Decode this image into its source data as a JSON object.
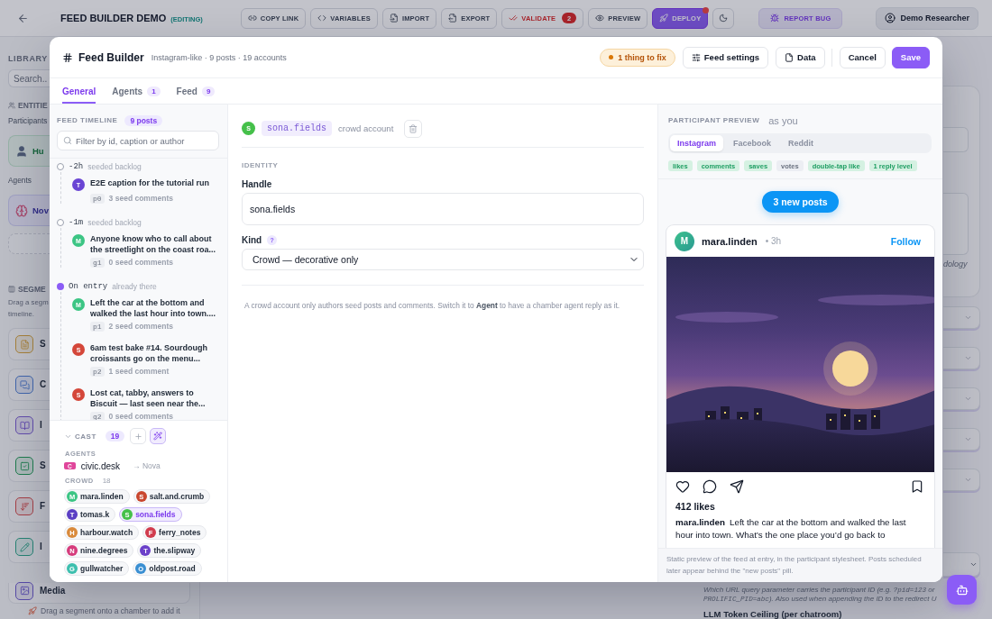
{
  "top_bar": {
    "title": "FEED BUILDER DEMO",
    "status": "(EDITING)",
    "actions": [
      {
        "kind": "link",
        "label": "COPY LINK",
        "alert": false
      },
      {
        "kind": "code",
        "label": "VARIABLES",
        "alert": false
      },
      {
        "kind": "import",
        "label": "IMPORT",
        "alert": false
      },
      {
        "kind": "export",
        "label": "EXPORT",
        "alert": false
      },
      {
        "kind": "validate",
        "label": "VALIDATE",
        "badge": "2",
        "alert": false
      },
      {
        "kind": "preview",
        "label": "PREVIEW",
        "alert": false
      },
      {
        "kind": "deploy",
        "label": "DEPLOY",
        "alert": true
      },
      {
        "kind": "theme",
        "alert": false
      }
    ],
    "report_label": "REPORT BUG",
    "user_label": "Demo Researcher"
  },
  "library": {
    "title": "LIBRARY",
    "search_placeholder": "Search..",
    "entities_heading": "ENTITIE",
    "participants_label": "Participants",
    "participant_card": "Hu",
    "agents_label": "Agents",
    "agent_card": "Nov",
    "segments_heading": "SEGME",
    "segments_hint": [
      "Drag a segm",
      "timeline."
    ],
    "segments": [
      {
        "kind": "document",
        "label": "S"
      },
      {
        "kind": "chat",
        "label": "C"
      },
      {
        "kind": "book",
        "label": "I"
      },
      {
        "kind": "check",
        "label": "S"
      },
      {
        "kind": "sort",
        "label": "F"
      },
      {
        "kind": "pencil",
        "label": "I"
      },
      {
        "kind": "media",
        "label": "Media"
      }
    ],
    "footer": "Drag a segment onto a chamber to add it"
  },
  "settings": {
    "hint_fragment": "dology",
    "help_lines": [
      [
        {
          "kind": "text",
          "text": "Which URL query parameter carries the participant ID (e.g. "
        },
        {
          "kind": "code",
          "text": "?pid=123"
        },
        {
          "kind": "text",
          "text": " or"
        }
      ],
      [
        {
          "kind": "code",
          "text": "PROLIFIC_PID=abc"
        },
        {
          "kind": "text",
          "text": "). Also used when appending the ID to the redirect U"
        }
      ]
    ],
    "ceiling_label": "LLM Token Ceiling (per chatroom)"
  },
  "modal": {
    "title": "Feed Builder",
    "summary": "Instagram-like · 9 posts · 19 accounts",
    "issues_label": "1 thing to fix",
    "tools": [
      {
        "kind": "settings",
        "label": "Feed settings"
      },
      {
        "kind": "data",
        "label": "Data"
      }
    ],
    "cancel_label": "Cancel",
    "save_label": "Save",
    "tabs": [
      {
        "label": "General",
        "selected": true
      },
      {
        "label": "Agents",
        "count": "1",
        "selected": false
      },
      {
        "label": "Feed",
        "count": "9",
        "selected": false
      }
    ],
    "timeline": {
      "heading": "FEED TIMELINE",
      "count": "9 posts",
      "search_placeholder": "Filter by id, caption or author",
      "groups": [
        {
          "label": "-2h",
          "note": "seeded backlog",
          "current": false,
          "posts": [
            {
              "initial": "T",
              "color": "#6a45d4",
              "text": "E2E caption for the tutorial run",
              "id": "p0",
              "comments": "3 seed comments"
            }
          ]
        },
        {
          "label": "-1m",
          "note": "seeded backlog",
          "current": false,
          "posts": [
            {
              "initial": "M",
              "color": "#3cc584",
              "text": "Anyone know who to call about the streetlight on the coast roa...",
              "id": "g1",
              "comments": "0 seed comments"
            }
          ]
        },
        {
          "label": "On entry",
          "note": "already there",
          "current": true,
          "posts": [
            {
              "initial": "M",
              "color": "#3cc584",
              "text": "Left the car at the bottom and walked the last hour into town....",
              "id": "p1",
              "comments": "2 seed comments"
            },
            {
              "initial": "S",
              "color": "#d4473a",
              "text": "6am test bake #14. Sourdough croissants go on the menu...",
              "id": "p2",
              "comments": "1 seed comment"
            },
            {
              "initial": "S",
              "color": "#d4473a",
              "text": "Lost cat, tabby, answers to Biscuit — last seen near the...",
              "id": "g2",
              "comments": "0 seed comments"
            }
          ]
        }
      ]
    },
    "cast": {
      "heading": "CAST",
      "count": "19",
      "expanded": true,
      "agents_heading": "AGENTS",
      "agents": [
        {
          "tag": "C",
          "handle": "civic.desk",
          "target": "→ Nova"
        }
      ],
      "crowd_heading": "CROWD",
      "crowd_count": "18",
      "crowd": [
        {
          "initial": "M",
          "handle": "mara.linden",
          "color": "#3cc584",
          "selected": false
        },
        {
          "initial": "S",
          "handle": "salt.and.crumb",
          "color": "#c9472f",
          "selected": false
        },
        {
          "initial": "T",
          "handle": "tomas.k",
          "color": "#5b3fc4",
          "selected": false
        },
        {
          "initial": "S",
          "handle": "sona.fields",
          "color": "#45c04a",
          "selected": true
        },
        {
          "initial": "H",
          "handle": "harbour.watch",
          "color": "#d98a3b",
          "selected": false
        },
        {
          "initial": "F",
          "handle": "ferry_notes",
          "color": "#d13c4e",
          "selected": false
        },
        {
          "initial": "N",
          "handle": "nine.degrees",
          "color": "#d63c7c",
          "selected": false
        },
        {
          "initial": "T",
          "handle": "the.slipway",
          "color": "#6b40c9",
          "selected": false
        },
        {
          "initial": "G",
          "handle": "gullwatcher",
          "color": "#3dbfae",
          "selected": false
        },
        {
          "initial": "O",
          "handle": "oldpost.road",
          "color": "#3a8fd2",
          "selected": false
        }
      ]
    },
    "account": {
      "initial": "S",
      "handle": "sona.fields",
      "kind_note": "crowd account",
      "section": "IDENTITY",
      "handle_label": "Handle",
      "handle_value": "sona.fields",
      "kind_label": "Kind",
      "kind_help": "?",
      "kind_value": "Crowd — decorative only",
      "note": "A crowd account only authors seed posts and comments. Switch it to **Agent** to have a chamber agent reply as it."
    },
    "preview": {
      "heading": "PARTICIPANT PREVIEW",
      "viewer": "as you",
      "platforms": [
        {
          "label": "Instagram",
          "selected": true
        },
        {
          "label": "Facebook",
          "selected": false
        },
        {
          "label": "Reddit",
          "selected": false
        }
      ],
      "features": [
        {
          "label": "likes",
          "on": true
        },
        {
          "label": "comments",
          "on": true
        },
        {
          "label": "saves",
          "on": true
        },
        {
          "label": "votes",
          "on": false
        },
        {
          "label": "double-tap like",
          "on": true
        },
        {
          "label": "1 reply level",
          "on": true
        }
      ],
      "new_posts_label": "3 new posts",
      "post": {
        "initial": "M",
        "author": "mara.linden",
        "age": "• 3h",
        "follow_label": "Follow",
        "likes": "412 likes",
        "caption_author": "mara.linden",
        "caption": "Left the car at the bottom and walked the last hour into town. What’s the one place you’d go back to"
      },
      "footer": "Static preview of the feed at entry, in the participant stylesheet. Posts scheduled later appear behind the \"new posts\" pill."
    }
  }
}
